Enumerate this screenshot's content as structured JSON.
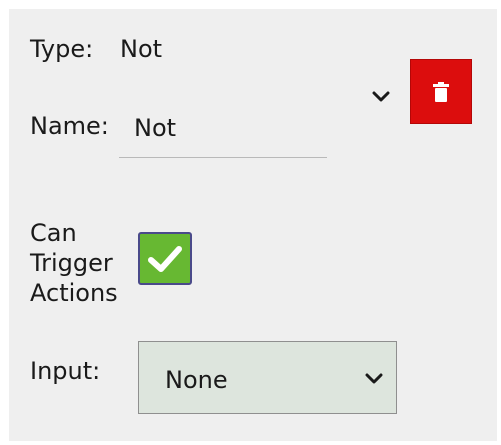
{
  "type_field": {
    "label": "Type:",
    "value": "Not"
  },
  "name_field": {
    "label": "Name:",
    "value": "Not"
  },
  "expand_icon": "chevron-down-icon",
  "delete_button": {
    "icon": "trash-icon",
    "color": "#dc0d0d"
  },
  "can_trigger": {
    "label_lines": [
      "Can",
      "Trigger",
      "Actions"
    ],
    "checked": true,
    "color": "#67b832"
  },
  "input_field": {
    "label": "Input:",
    "selected": "None",
    "icon": "chevron-down-icon"
  }
}
